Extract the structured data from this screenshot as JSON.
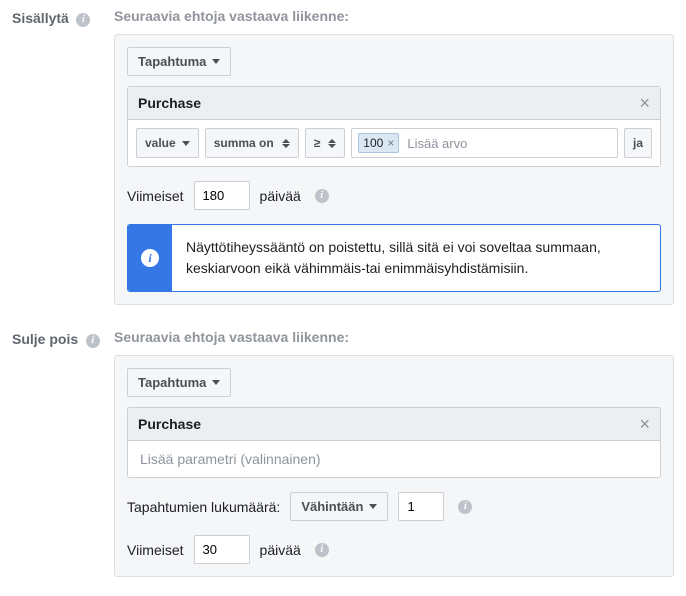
{
  "include": {
    "label": "Sisällytä",
    "subhead": "Seuraavia ehtoja vastaava liikenne:",
    "event_dropdown": "Tapahtuma",
    "rule_title": "Purchase",
    "param": "value",
    "aggregate": "summa on",
    "operator": "≥",
    "chip_value": "100",
    "add_value_placeholder": "Lisää arvo",
    "and_label": "ja",
    "last_label": "Viimeiset",
    "days_value": "180",
    "days_label": "päivää",
    "alert": "Näyttötiheyssääntö on poistettu, sillä sitä ei voi soveltaa summaan, keskiarvoon eikä vähimmäis-tai enimmäisyhdistämisiin."
  },
  "exclude": {
    "label": "Sulje pois",
    "subhead": "Seuraavia ehtoja vastaava liikenne:",
    "event_dropdown": "Tapahtuma",
    "rule_title": "Purchase",
    "param_placeholder": "Lisää parametri (valinnainen)",
    "count_label": "Tapahtumien lukumäärä:",
    "count_op": "Vähintään",
    "count_value": "1",
    "last_label": "Viimeiset",
    "days_value": "30",
    "days_label": "päivää"
  }
}
